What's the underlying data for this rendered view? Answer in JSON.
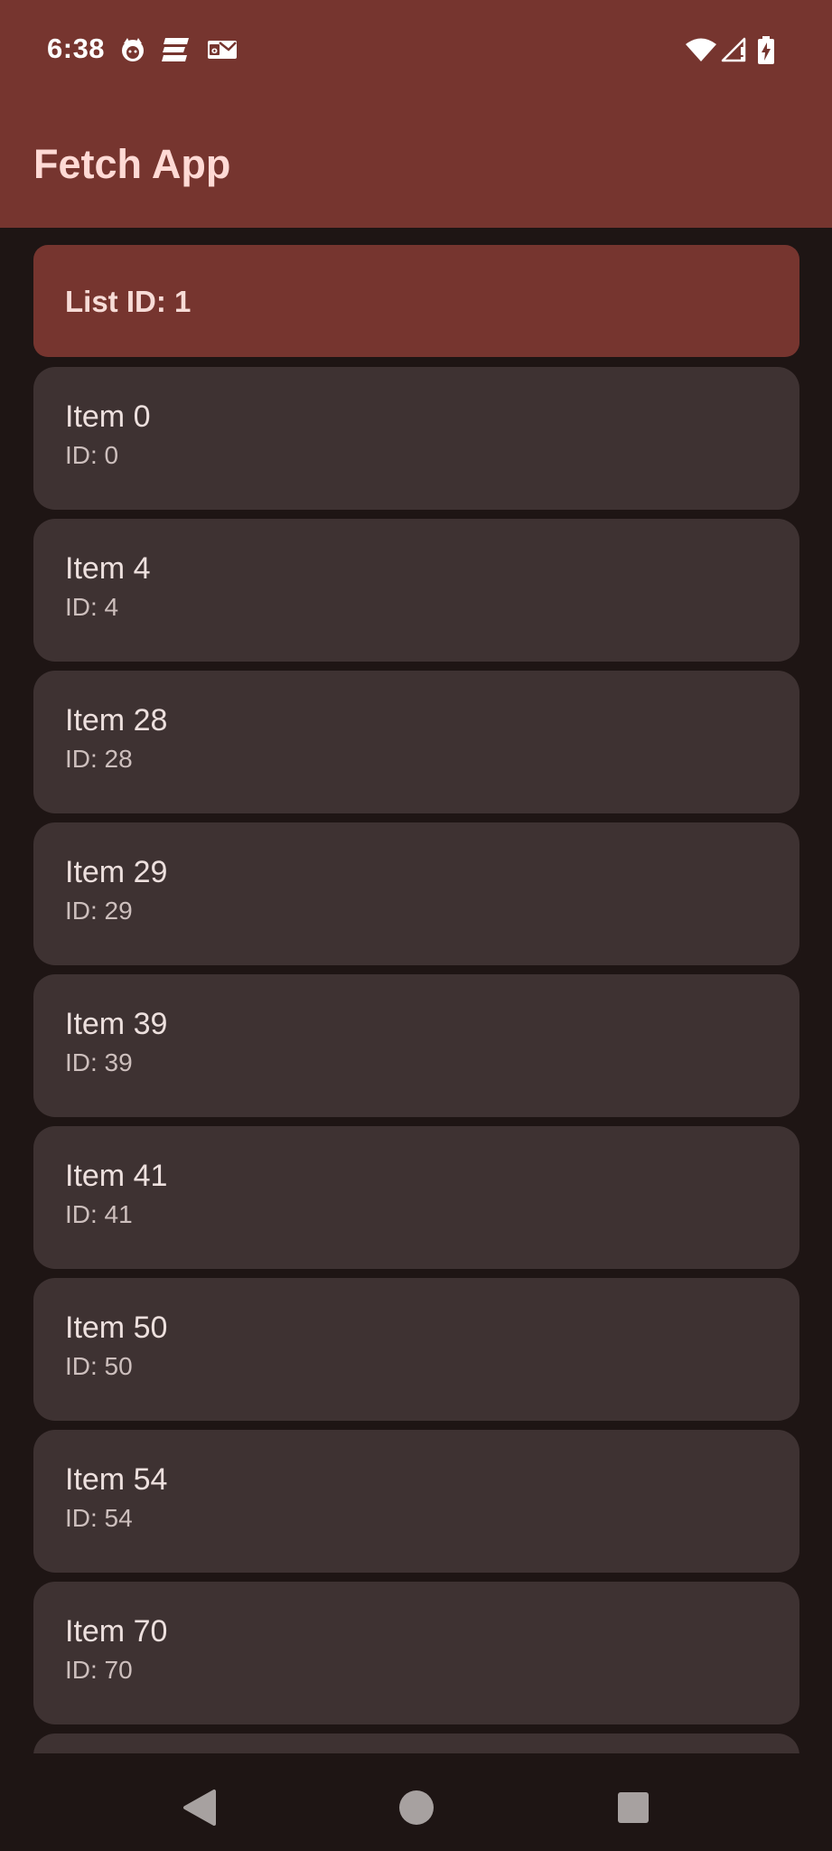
{
  "status_bar": {
    "time": "6:38",
    "left_icons": [
      "cat-notification-icon",
      "app-e-notification-icon",
      "mail-notification-icon"
    ],
    "right_icons": [
      "wifi-icon",
      "cell-signal-icon",
      "battery-charging-icon"
    ]
  },
  "app_bar": {
    "title": "Fetch App",
    "color": "#76352f"
  },
  "list": {
    "header_label": "List ID: 1",
    "items": [
      {
        "name": "Item 0",
        "id_label": "ID: 0"
      },
      {
        "name": "Item 4",
        "id_label": "ID: 4"
      },
      {
        "name": "Item 28",
        "id_label": "ID: 28"
      },
      {
        "name": "Item 29",
        "id_label": "ID: 29"
      },
      {
        "name": "Item 39",
        "id_label": "ID: 39"
      },
      {
        "name": "Item 41",
        "id_label": "ID: 41"
      },
      {
        "name": "Item 50",
        "id_label": "ID: 50"
      },
      {
        "name": "Item 54",
        "id_label": "ID: 54"
      },
      {
        "name": "Item 70",
        "id_label": "ID: 70"
      },
      {
        "name": "",
        "id_label": ""
      }
    ]
  },
  "nav_bar": {
    "buttons": [
      "back-icon",
      "home-icon",
      "recents-icon"
    ]
  },
  "colors": {
    "primary": "#76352f",
    "background": "#1e1514",
    "card": "#3e3232",
    "title_text": "#ffdad5"
  }
}
